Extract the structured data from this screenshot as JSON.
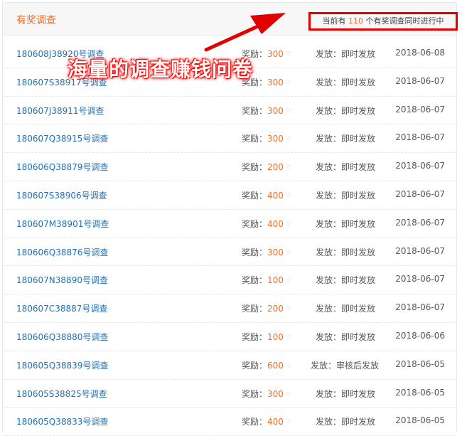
{
  "header": {
    "title": "有奖调查",
    "count_prefix": "当前有",
    "count_value": "110",
    "count_suffix": "个有奖调查同时进行中"
  },
  "overlay_caption": "海量的调查赚钱问卷",
  "labels": {
    "reward_label": "奖励：",
    "distribution_label": "发放："
  },
  "icons": {
    "reward_unit": "gem-icon",
    "arrow": "red-arrow-icon"
  },
  "colors": {
    "accent": "#ff6a1a",
    "link": "#1f72b8",
    "highlight": "#e00000"
  },
  "surveys": [
    {
      "name": "180608J38920号调查",
      "reward": "300",
      "distribution": "即时发放",
      "date": "2018-06-08"
    },
    {
      "name": "180607S38917号调查",
      "reward": "300",
      "distribution": "即时发放",
      "date": "2018-06-07"
    },
    {
      "name": "180607J38911号调查",
      "reward": "300",
      "distribution": "即时发放",
      "date": "2018-06-07"
    },
    {
      "name": "180607Q38915号调查",
      "reward": "300",
      "distribution": "即时发放",
      "date": "2018-06-07"
    },
    {
      "name": "180606Q38879号调查",
      "reward": "200",
      "distribution": "即时发放",
      "date": "2018-06-07"
    },
    {
      "name": "180607S38906号调查",
      "reward": "400",
      "distribution": "即时发放",
      "date": "2018-06-07"
    },
    {
      "name": "180607M38901号调查",
      "reward": "400",
      "distribution": "即时发放",
      "date": "2018-06-07"
    },
    {
      "name": "180606Q38876号调查",
      "reward": "300",
      "distribution": "即时发放",
      "date": "2018-06-07"
    },
    {
      "name": "180607N38890号调查",
      "reward": "100",
      "distribution": "即时发放",
      "date": "2018-06-07"
    },
    {
      "name": "180607C38887号调查",
      "reward": "200",
      "distribution": "即时发放",
      "date": "2018-06-07"
    },
    {
      "name": "180606Q38880号调查",
      "reward": "100",
      "distribution": "即时发放",
      "date": "2018-06-06"
    },
    {
      "name": "180605Q38839号调查",
      "reward": "600",
      "distribution": "审核后发放",
      "date": "2018-06-05"
    },
    {
      "name": "180605S38825号调查",
      "reward": "300",
      "distribution": "即时发放",
      "date": "2018-06-05"
    },
    {
      "name": "180605Q38833号调查",
      "reward": "400",
      "distribution": "即时发放",
      "date": "2018-06-05"
    }
  ]
}
